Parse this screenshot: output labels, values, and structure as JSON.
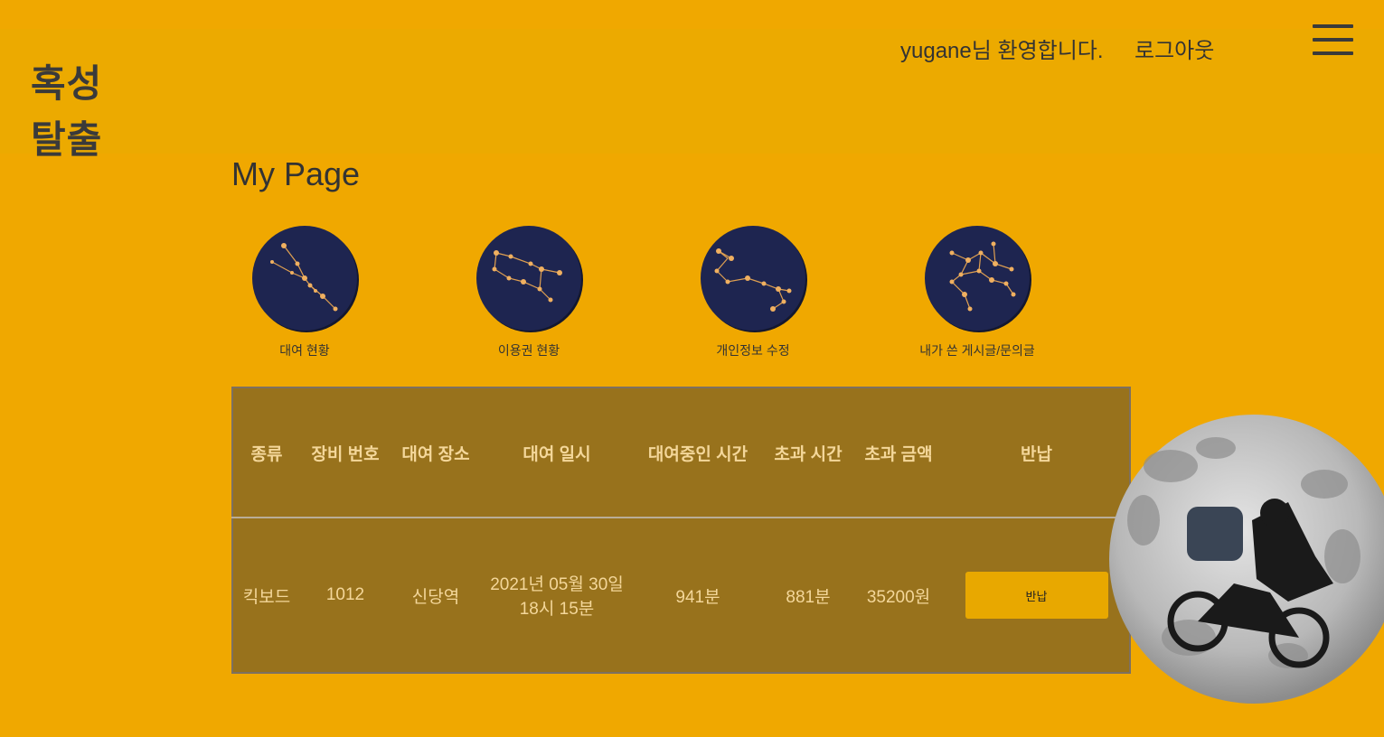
{
  "header": {
    "logo_line1": "혹성",
    "logo_line2": "탈출",
    "welcome": "yugane님 환영합니다.",
    "logout": "로그아웃"
  },
  "page": {
    "title": "My Page"
  },
  "menu": [
    {
      "label": "대여 현황",
      "icon": "constellation-taurus-icon"
    },
    {
      "label": "이용권 현황",
      "icon": "constellation-gemini-icon"
    },
    {
      "label": "개인정보 수정",
      "icon": "constellation-scorpio-icon"
    },
    {
      "label": "내가 쓴 게시글/문의글",
      "icon": "constellation-map-icon"
    }
  ],
  "table": {
    "headers": [
      "종류",
      "장비 번호",
      "대여 장소",
      "대여 일시",
      "대여중인 시간",
      "초과 시간",
      "초과 금액",
      "반납"
    ],
    "row": {
      "type": "킥보드",
      "device_no": "1012",
      "place": "신당역",
      "datetime_line1": "2021년 05월 30일",
      "datetime_line2": "18시 15분",
      "rent_time": "941분",
      "over_time": "881분",
      "over_fee": "35200원",
      "return_label": "반납"
    }
  },
  "colors": {
    "background": "#f0a800",
    "header": "#ecaa00",
    "table": "#98721c",
    "table_text": "#f4d79a",
    "circle": "#1e2550"
  }
}
